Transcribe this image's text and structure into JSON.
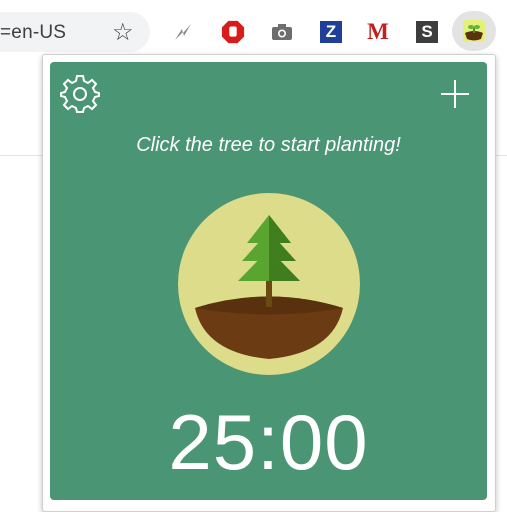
{
  "browser": {
    "address_text": "=en-US",
    "bookmark_icon": "star-icon",
    "extensions": [
      {
        "name": "zap-extension",
        "icon": "lightning-icon"
      },
      {
        "name": "adblock-extension",
        "icon": "stop-hand-icon"
      },
      {
        "name": "screenshot-extension",
        "icon": "camera-icon"
      },
      {
        "name": "z-extension",
        "label": "Z",
        "color": "#1f3f98"
      },
      {
        "name": "gmail-extension",
        "label": "M",
        "color": "#c41f1f"
      },
      {
        "name": "s-extension",
        "label": "S",
        "color": "#3d3d3d"
      },
      {
        "name": "forest-extension",
        "icon": "sprout-icon",
        "active": true
      }
    ]
  },
  "popup": {
    "settings_icon": "gear-icon",
    "add_icon": "plus-icon",
    "prompt": "Click the tree to start planting!",
    "tree_icon": "tree-icon",
    "timer": "25:00",
    "colors": {
      "background": "#4a9574",
      "tree_circle": "#dcdc8a",
      "soil": "#6b3c13",
      "tree": "#5aa530"
    }
  }
}
